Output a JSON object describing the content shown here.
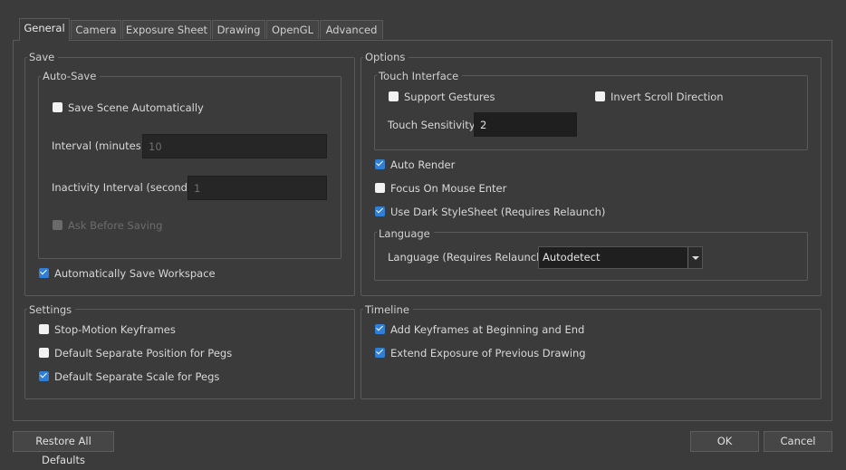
{
  "tabs": [
    {
      "label": "General",
      "active": true
    },
    {
      "label": "Camera"
    },
    {
      "label": "Exposure Sheet"
    },
    {
      "label": "Drawing"
    },
    {
      "label": "OpenGL"
    },
    {
      "label": "Advanced"
    }
  ],
  "save": {
    "title": "Save",
    "autosave_title": "Auto-Save",
    "save_scene_auto": {
      "label": "Save Scene Automatically",
      "checked": false
    },
    "interval_label": "Interval (minutes)",
    "interval_value": "10",
    "inactivity_label": "Inactivity Interval (seconds)",
    "inactivity_value": "1",
    "ask_before_saving": {
      "label": "Ask Before Saving",
      "checked": false,
      "disabled": true
    },
    "auto_save_workspace": {
      "label": "Automatically Save Workspace",
      "checked": true
    }
  },
  "options": {
    "title": "Options",
    "touch_title": "Touch Interface",
    "support_gestures": {
      "label": "Support Gestures",
      "checked": false
    },
    "invert_scroll": {
      "label": "Invert Scroll Direction",
      "checked": false
    },
    "touch_sensitivity_label": "Touch Sensitivity",
    "touch_sensitivity_value": "2",
    "auto_render": {
      "label": "Auto Render",
      "checked": true
    },
    "focus_mouse": {
      "label": "Focus On Mouse Enter",
      "checked": false
    },
    "dark_stylesheet": {
      "label": "Use Dark StyleSheet (Requires Relaunch)",
      "checked": true
    },
    "language_title": "Language",
    "language_label": "Language (Requires Relaunch)",
    "language_value": "Autodetect"
  },
  "settings": {
    "title": "Settings",
    "stop_motion": {
      "label": "Stop-Motion Keyframes",
      "checked": false
    },
    "sep_position": {
      "label": "Default Separate Position for Pegs",
      "checked": false
    },
    "sep_scale": {
      "label": "Default Separate Scale for Pegs",
      "checked": true
    }
  },
  "timeline": {
    "title": "Timeline",
    "add_keyframes": {
      "label": "Add Keyframes at Beginning and End",
      "checked": true
    },
    "extend_exposure": {
      "label": "Extend Exposure of Previous Drawing",
      "checked": true
    }
  },
  "footer": {
    "restore_label": "Restore All Defaults",
    "ok_label": "OK",
    "cancel_label": "Cancel"
  },
  "colors": {
    "background": "#3b3b3b",
    "checkbox_checked": "#2f7fd6",
    "input_bg": "#1f1f1f"
  }
}
